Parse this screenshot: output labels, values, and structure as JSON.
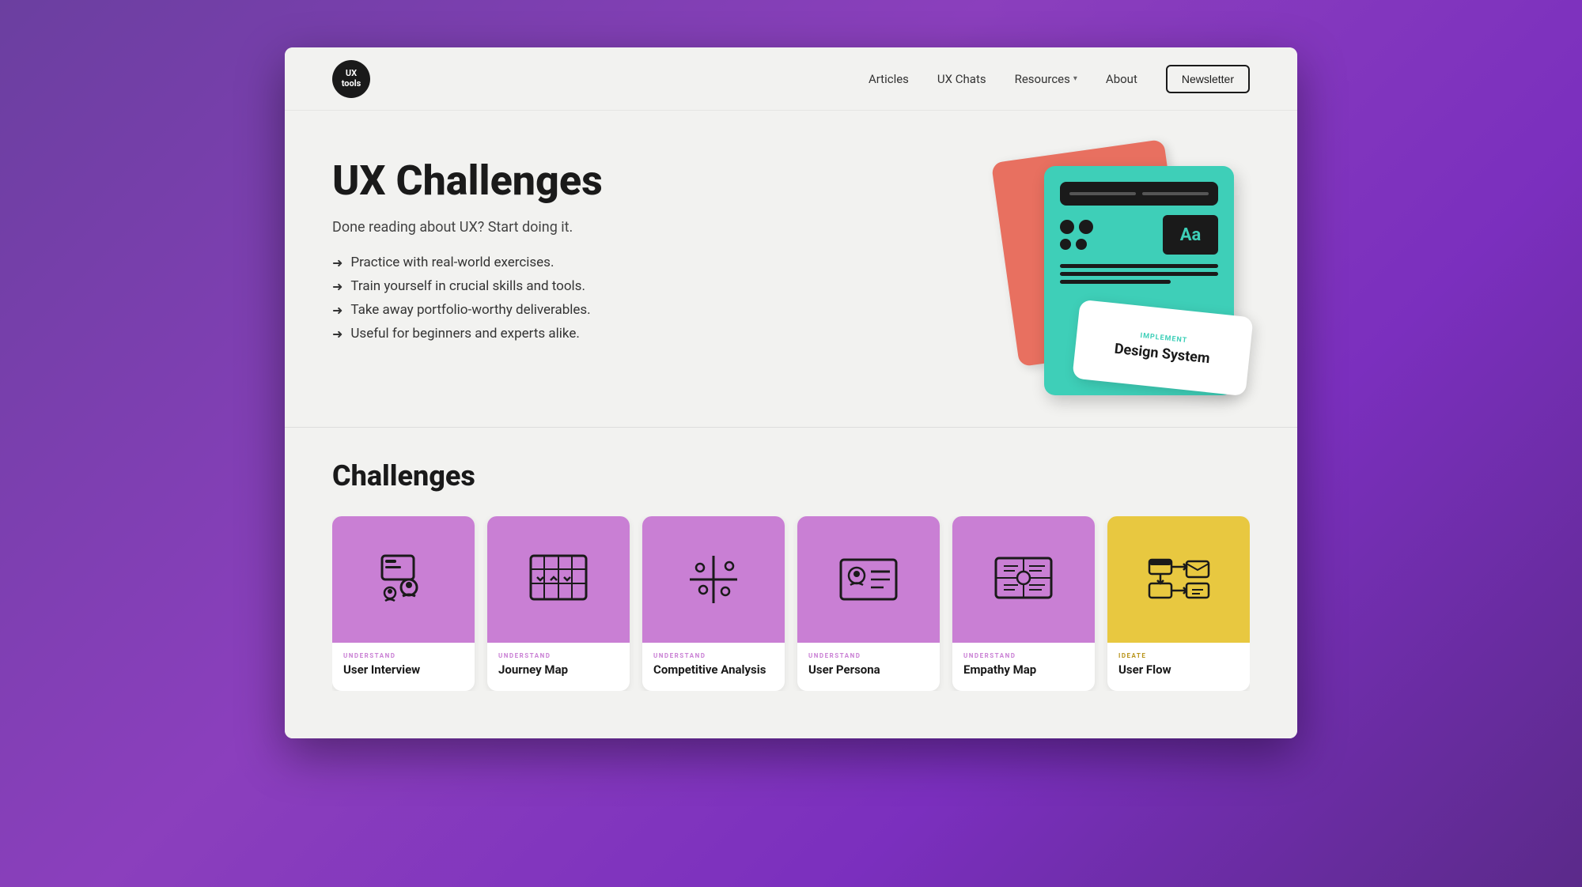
{
  "logo": {
    "line1": "UX",
    "line2": "tools"
  },
  "navbar": {
    "links": [
      {
        "label": "Articles",
        "has_dropdown": false
      },
      {
        "label": "UX Chats",
        "has_dropdown": false
      },
      {
        "label": "Resources",
        "has_dropdown": true
      },
      {
        "label": "About",
        "has_dropdown": false
      }
    ],
    "newsletter_button": "Newsletter"
  },
  "hero": {
    "title": "UX Challenges",
    "subtitle": "Done reading about UX? Start doing it.",
    "bullets": [
      "Practice with real-world exercises.",
      "Train yourself in crucial skills and tools.",
      "Take away portfolio-worthy deliverables.",
      "Useful for beginners and experts alike."
    ],
    "card_bottom_label": "IMPLEMENT",
    "card_bottom_title": "Design System"
  },
  "challenges": {
    "heading": "Challenges",
    "cards": [
      {
        "category": "UNDERSTAND",
        "title": "User Interview",
        "color": "purple",
        "icon_type": "user-interview"
      },
      {
        "category": "UNDERSTAND",
        "title": "Journey Map",
        "color": "purple",
        "icon_type": "journey-map"
      },
      {
        "category": "UNDERSTAND",
        "title": "Competitive Analysis",
        "color": "purple",
        "icon_type": "competitive-analysis"
      },
      {
        "category": "UNDERSTAND",
        "title": "User Persona",
        "color": "purple",
        "icon_type": "user-persona"
      },
      {
        "category": "UNDERSTAND",
        "title": "Empathy Map",
        "color": "purple",
        "icon_type": "empathy-map"
      },
      {
        "category": "IDEATE",
        "title": "User Flow",
        "color": "yellow",
        "icon_type": "user-flow"
      }
    ]
  }
}
